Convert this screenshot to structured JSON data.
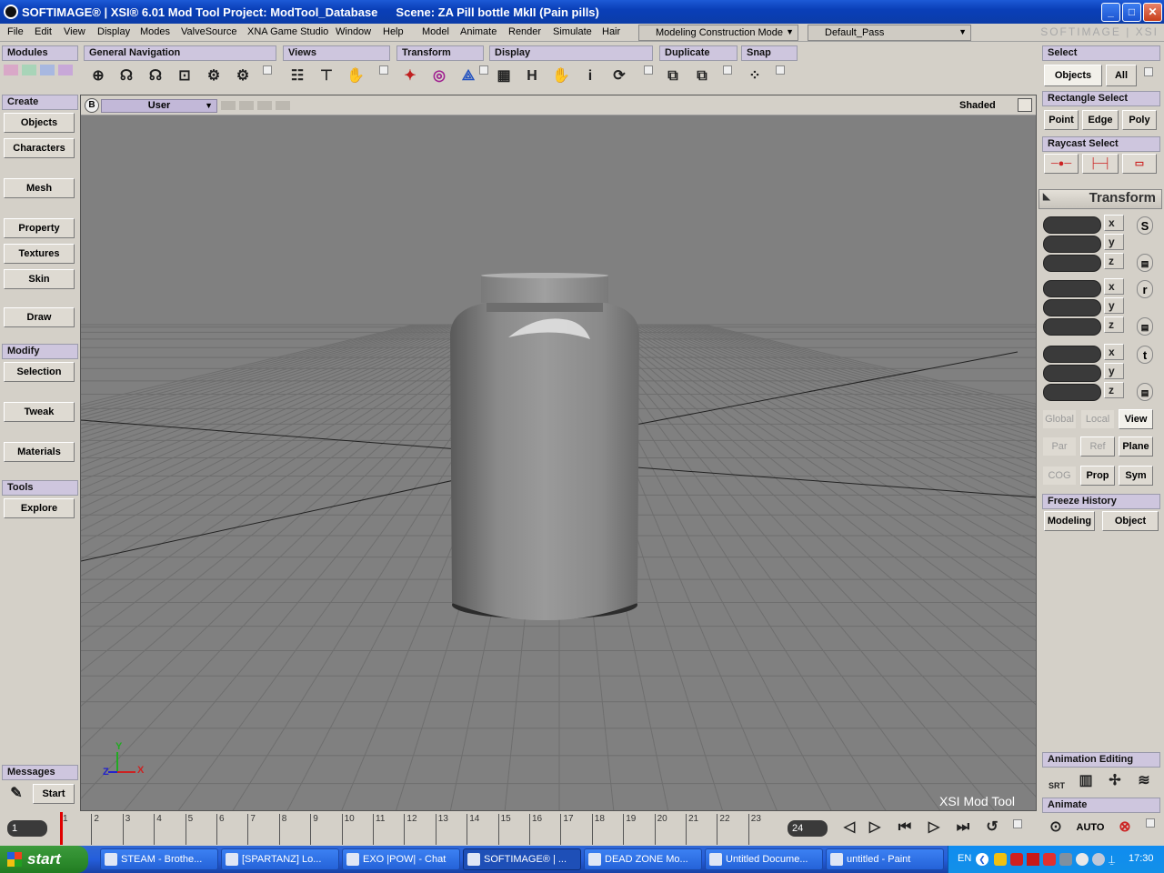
{
  "titlebar": {
    "title": "SOFTIMAGE® | XSI® 6.01 Mod Tool Project: ModTool_Database",
    "scene": "Scene: ZA Pill bottle MkII (Pain pills)",
    "min": "_",
    "max": "□",
    "close": "✕"
  },
  "menu": {
    "items": [
      "File",
      "Edit",
      "View",
      "Display",
      "Modes",
      "ValveSource",
      "XNA Game Studio",
      "Window",
      "Help"
    ],
    "items2": [
      "Model",
      "Animate",
      "Render",
      "Simulate",
      "Hair"
    ],
    "mode": "Modeling Construction Mode",
    "pass": "Default_Pass",
    "brand": "SOFTIMAGE | XSI"
  },
  "toolbar": {
    "modules": "Modules",
    "general_navigation": "General Navigation",
    "views": "Views",
    "transform": "Transform",
    "display": "Display",
    "duplicate": "Duplicate",
    "snap": "Snap",
    "h_icon": "H",
    "i_icon": "i"
  },
  "left_panel": {
    "create": "Create",
    "objects": "Objects",
    "characters": "Characters",
    "mesh": "Mesh",
    "property": "Property",
    "textures": "Textures",
    "skin": "Skin",
    "draw": "Draw",
    "modify": "Modify",
    "selection": "Selection",
    "tweak": "Tweak",
    "materials": "Materials",
    "tools": "Tools",
    "explore": "Explore",
    "messages": "Messages",
    "start": "Start"
  },
  "viewport": {
    "badge": "B",
    "camera": "User",
    "shading": "Shaded",
    "watermark": "XSI Mod Tool",
    "axis_x": "X",
    "axis_y": "Y",
    "axis_z": "Z"
  },
  "right_panel": {
    "select": "Select",
    "objects": "Objects",
    "all": "All",
    "rectangle_select": "Rectangle Select",
    "point": "Point",
    "edge": "Edge",
    "poly": "Poly",
    "raycast_select": "Raycast Select",
    "transform": "Transform",
    "axes": [
      "x",
      "y",
      "z",
      "x",
      "y",
      "z",
      "x",
      "y",
      "z"
    ],
    "s": "S",
    "r": "r",
    "t": "t",
    "global": "Global",
    "local": "Local",
    "view": "View",
    "par": "Par",
    "ref": "Ref",
    "plane": "Plane",
    "cog": "COG",
    "prop": "Prop",
    "sym": "Sym",
    "freeze_history": "Freeze History",
    "modeling": "Modeling",
    "object": "Object",
    "animation_editing": "Animation Editing",
    "srt": "SRT",
    "animate": "Animate",
    "auto": "AUTO"
  },
  "timeline": {
    "start_frame": "1",
    "end_frame": "24",
    "ticks": [
      "1",
      "2",
      "3",
      "4",
      "5",
      "6",
      "7",
      "8",
      "9",
      "10",
      "11",
      "12",
      "13",
      "14",
      "15",
      "16",
      "17",
      "18",
      "19",
      "20",
      "21",
      "22",
      "23"
    ]
  },
  "taskbar": {
    "start": "start",
    "tasks": [
      "STEAM - Brothe...",
      "[SPARTANZ] Lo...",
      "EXO |POW| - Chat",
      "SOFTIMAGE® | ...",
      "DEAD ZONE Mo...",
      "Untitled Docume...",
      "untitled - Paint"
    ],
    "lang": "EN",
    "clock": "17:30"
  },
  "colors": {
    "titlebar": "#0a3fb8",
    "panel_header": "#cec6de",
    "viewport_bg": "#808080",
    "taskbar": "#245edb",
    "start_button": "#2c8a2c",
    "timeline_marker": "#e00000"
  }
}
